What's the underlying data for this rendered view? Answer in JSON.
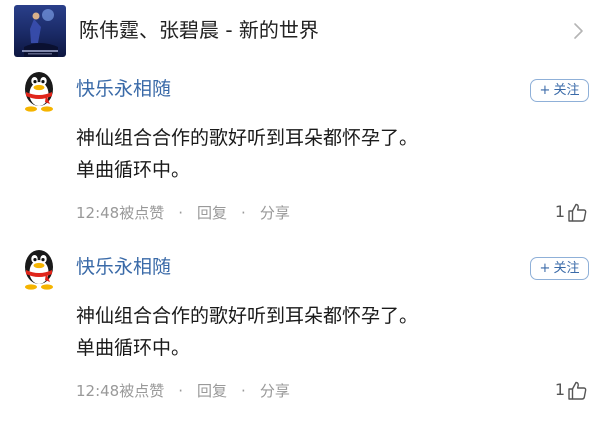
{
  "song": {
    "title": "陈伟霆、张碧晨 - 新的世界",
    "icons": {
      "album": "album-cover-art",
      "open": "chevron-right-icon"
    }
  },
  "comments": [
    {
      "username": "快乐永相随",
      "follow_label": "关注",
      "lines": [
        "神仙组合合作的歌好听到耳朵都怀孕了。",
        "单曲循环中。"
      ],
      "time": "12:48",
      "liked_by_label": "被点赞",
      "reply_label": "回复",
      "share_label": "分享",
      "like_count": "1",
      "icons": {
        "avatar": "penguin-avatar",
        "like": "thumbs-up-icon"
      }
    },
    {
      "username": "快乐永相随",
      "follow_label": "关注",
      "lines": [
        "神仙组合合作的歌好听到耳朵都怀孕了。",
        "单曲循环中。"
      ],
      "time": "12:48",
      "liked_by_label": "被点赞",
      "reply_label": "回复",
      "share_label": "分享",
      "like_count": "1",
      "icons": {
        "avatar": "penguin-avatar",
        "like": "thumbs-up-icon"
      }
    }
  ],
  "colors": {
    "username": "#3a6aa8",
    "meta_text": "#999999",
    "follow_border": "#8fb0d8",
    "body_text": "#1a1a1a"
  }
}
